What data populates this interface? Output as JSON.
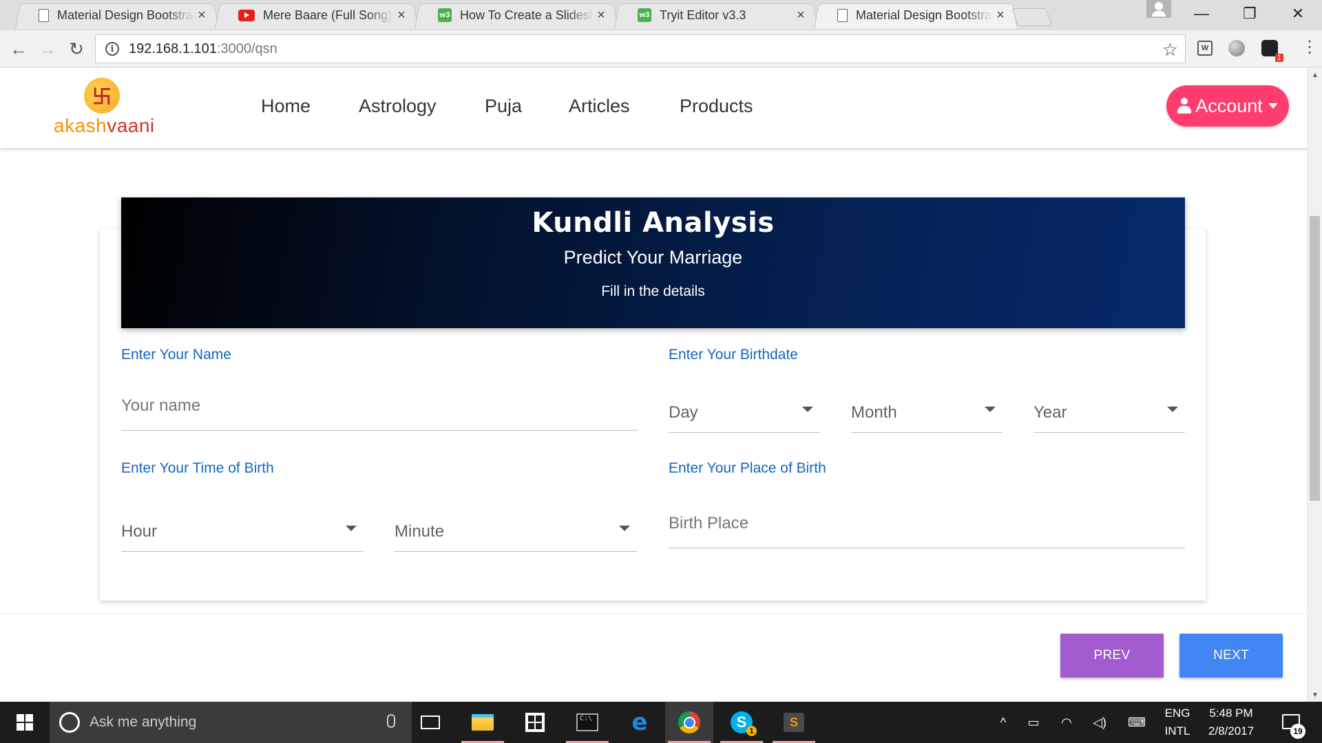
{
  "browser": {
    "tabs": [
      {
        "title": "Material Design Bootstrap",
        "icon": "doc-icon"
      },
      {
        "title": "Mere Baare (Full Song) Baar Baar Dekho",
        "icon": "youtube-icon"
      },
      {
        "title": "How To Create a Slideshow",
        "icon": "w3-icon"
      },
      {
        "title": "Tryit Editor v3.3",
        "icon": "w3-icon"
      },
      {
        "title": "Material Design Bootstrap",
        "icon": "doc-icon"
      }
    ],
    "url_host": "192.168.1.101",
    "url_path": ":3000/qsn",
    "extension_badge": "1"
  },
  "site": {
    "logo_part1": "akash",
    "logo_part2": "vaani",
    "logo_symbol": "卐",
    "nav": [
      "Home",
      "Astrology",
      "Puja",
      "Articles",
      "Products"
    ],
    "account_label": "Account",
    "accent_color": "#ff3c6e"
  },
  "hero": {
    "title": "Kundli Analysis",
    "subtitle": "Predict Your Marriage",
    "instruction": "Fill in the details"
  },
  "form": {
    "name_label": "Enter Your Name",
    "name_placeholder": "Your name",
    "birthdate_label": "Enter Your Birthdate",
    "day": "Day",
    "month": "Month",
    "year": "Year",
    "time_label": "Enter Your Time of Birth",
    "hour": "Hour",
    "minute": "Minute",
    "place_label": "Enter Your Place of Birth",
    "place_placeholder": "Birth Place"
  },
  "buttons": {
    "prev": "PREV",
    "next": "NEXT",
    "prev_color": "#a25ccf",
    "next_color": "#4285f4"
  },
  "taskbar": {
    "search_placeholder": "Ask me anything",
    "lang_top": "ENG",
    "lang_bottom": "INTL",
    "time": "5:48 PM",
    "date": "2/8/2017",
    "notification_count": "19"
  }
}
